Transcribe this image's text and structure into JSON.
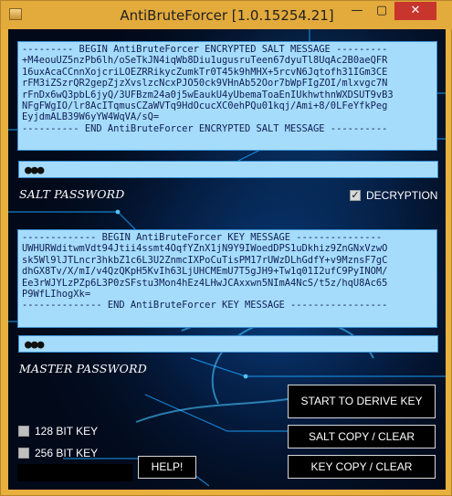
{
  "window": {
    "title": "AntiBruteForcer [1.0.15254.21]",
    "minimize_glyph": "—",
    "maximize_glyph": "▢",
    "close_glyph": "✕"
  },
  "salt_message": {
    "text": "--------- BEGIN AntiBruteForcer ENCRYPTED SALT MESSAGE ---------\n+M4eouUZ5nzPb6lh/oSeTkJN4iqWb8Diu1ugusruTeen67dyuTl8UqAc2B0aeQFR\n16uxAcaCCnnXojcriLOEZRRikycZumkTr0T45k9hMHX+5rcvN6Jqtofh31IGm3CE\nrFM3iZSzrQR2gepZjzXvslzcNcxPJO50ck9VHnAb52Oor7bWpFIgZOI/mlxvgc7N\nrFnDx6wQ3pbL6jyQ/3UFBzm24a0j5wEaukU4yUbemaToaEnIUkhwthnWXDSUT9vB3\nNFgFWgIO/lr8AcITqmusCZaWVTq9HdOcucXC0ehPQu01kqj/Ami+8/0LFeYfkPeg\nEyjdmALB39W6yYW4WqVA/sQ=\n---------- END AntiBruteForcer ENCRYPTED SALT MESSAGE ----------"
  },
  "salt_password": {
    "masked": "●●●",
    "label": "SALT PASSWORD"
  },
  "decryption": {
    "label": "DECRYPTION",
    "checked": true
  },
  "key_message": {
    "text": "------------- BEGIN AntiBruteForcer KEY MESSAGE ---------------\nUWHURWditwmVdt94Jtii4ssmt4OqfYZnX1jN9Y9IWoedDPS1uDkhiz9ZnGNxVzwO\nsk5Wl9lJTLncr3hkbZ1c6L3U2ZnmcIXPoCuTisPM17rUWzDLhGdfY+v9MznsF7gC\ndhGX8Tv/X/mI/v4QzQKpH5KvIh63LjUHCMEmU7T5gJH9+Tw1q01I2ufC9PyINOM/\nEe3rWJYLzPZp6L3P0zSFstu3Mon4hEz4LHwJCAxxwn5NImA4NcS/t5z/hqU8Ac65\nP9WfLIhogXk=\n-------------- END AntiBruteForcer KEY MESSAGE -----------------"
  },
  "master_password": {
    "masked": "●●●",
    "label": "MASTER PASSWORD"
  },
  "options": {
    "bit128_label": "128 BIT KEY",
    "bit256_label": "256 BIT KEY",
    "bit128_checked": false,
    "bit256_checked": false
  },
  "buttons": {
    "derive": "START TO DERIVE KEY",
    "salt_copy": "SALT COPY / CLEAR",
    "key_copy": "KEY COPY / CLEAR",
    "help": "HELP!"
  },
  "colors": {
    "title_bar": "#e3aa3c",
    "close_button": "#c7352c",
    "text_box_bg": "#a6dcfb",
    "client_bg": "#020a1a"
  }
}
